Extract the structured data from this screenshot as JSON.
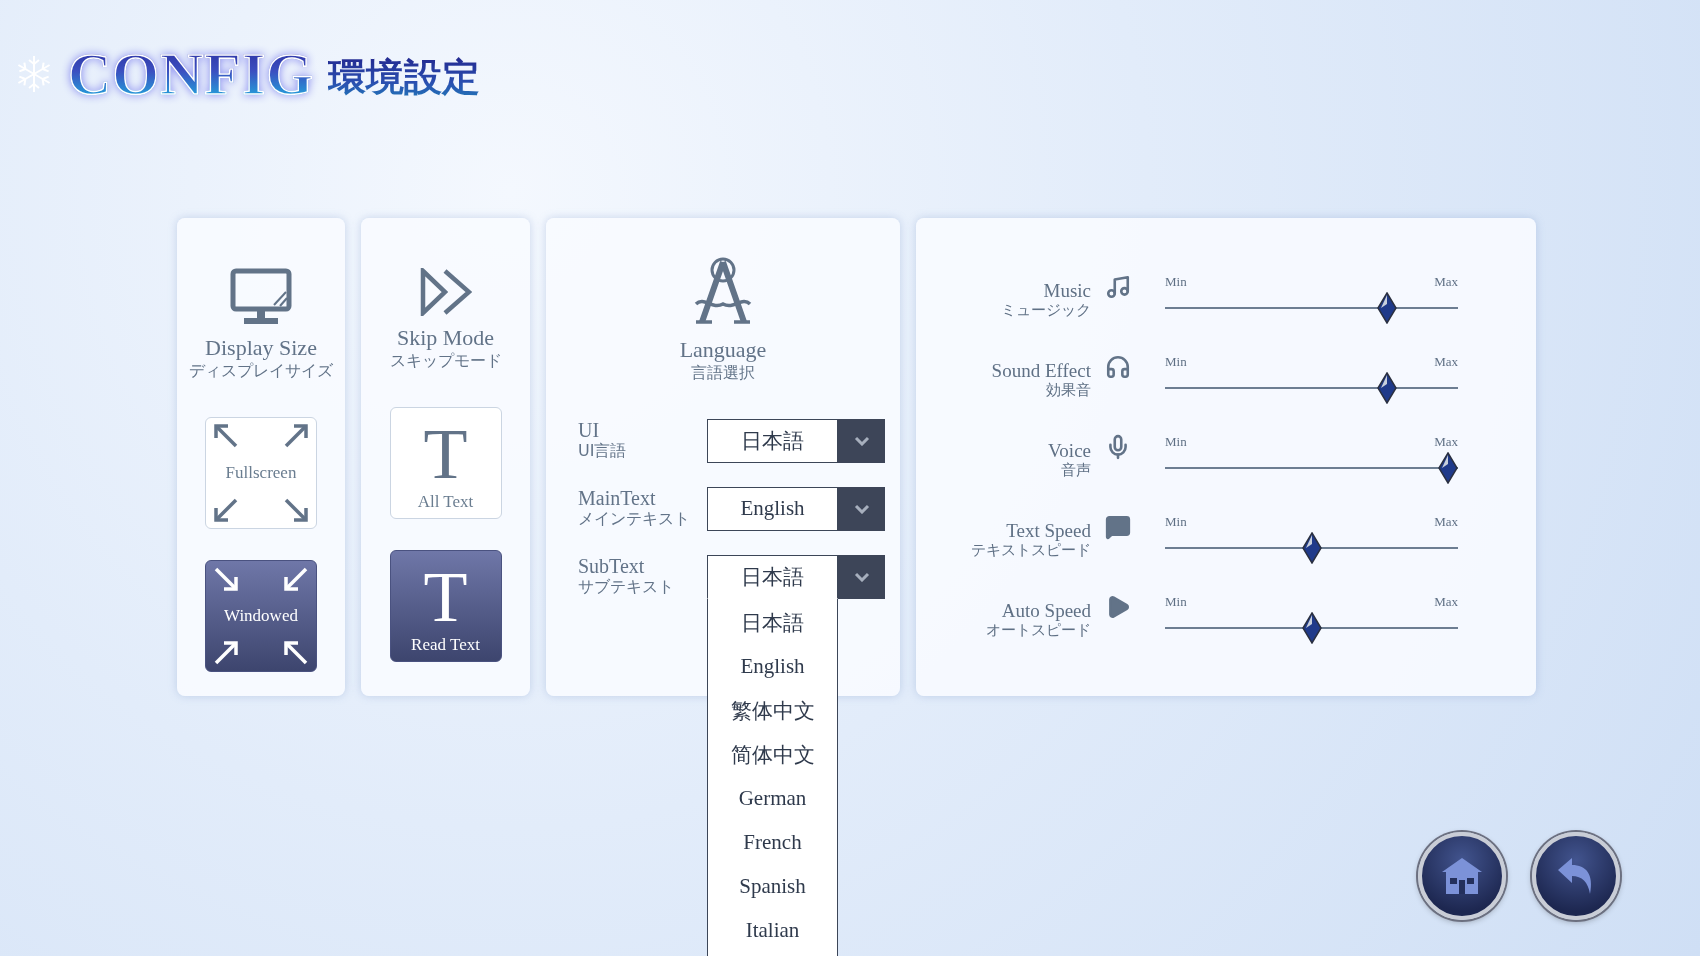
{
  "header": {
    "title": "CONFIG",
    "subtitle": "環境設定"
  },
  "toggle_panels": [
    {
      "kind": "display",
      "title": "Display Size",
      "subtitle": "ディスプレイサイズ",
      "options": [
        {
          "kind": "fullscreen",
          "label": "Fullscreen",
          "selected": false
        },
        {
          "kind": "windowed",
          "label": "Windowed",
          "selected": true
        }
      ]
    },
    {
      "kind": "skip",
      "title": "Skip Mode",
      "subtitle": "スキップモード",
      "options": [
        {
          "kind": "glyph",
          "glyph": "T",
          "label": "All Text",
          "selected": false
        },
        {
          "kind": "glyph",
          "glyph": "T",
          "label": "Read Text",
          "selected": true
        }
      ]
    }
  ],
  "language": {
    "title": "Language",
    "subtitle": "言語選択",
    "settings": [
      {
        "label": "UI",
        "sublabel": "UI言語",
        "value": "日本語",
        "expanded": false
      },
      {
        "label": "MainText",
        "sublabel": "メインテキスト",
        "value": "English",
        "expanded": false
      },
      {
        "label": "SubText",
        "sublabel": "サブテキスト",
        "value": "日本語",
        "expanded": true,
        "options": [
          "日本語",
          "English",
          "繁体中文",
          "简体中文",
          "German",
          "French",
          "Spanish",
          "Italian"
        ]
      }
    ]
  },
  "sliders": [
    {
      "kind": "music",
      "label": "Music",
      "sublabel": "ミュージック",
      "min_label": "Min",
      "max_label": "Max",
      "level": 0.775
    },
    {
      "kind": "sound",
      "label": "Sound Effect",
      "sublabel": "効果音",
      "min_label": "Min",
      "max_label": "Max",
      "level": 0.775
    },
    {
      "kind": "voice",
      "label": "Voice",
      "sublabel": "音声",
      "min_label": "Min",
      "max_label": "Max",
      "level": 1.0
    },
    {
      "kind": "text",
      "label": "Text Speed",
      "sublabel": "テキストスピード",
      "min_label": "Min",
      "max_label": "Max",
      "level": 0.5
    },
    {
      "kind": "auto",
      "label": "Auto Speed",
      "sublabel": "オートスピード",
      "min_label": "Min",
      "max_label": "Max",
      "level": 0.5
    }
  ],
  "nav_buttons": [
    {
      "kind": "home"
    },
    {
      "kind": "back"
    }
  ]
}
